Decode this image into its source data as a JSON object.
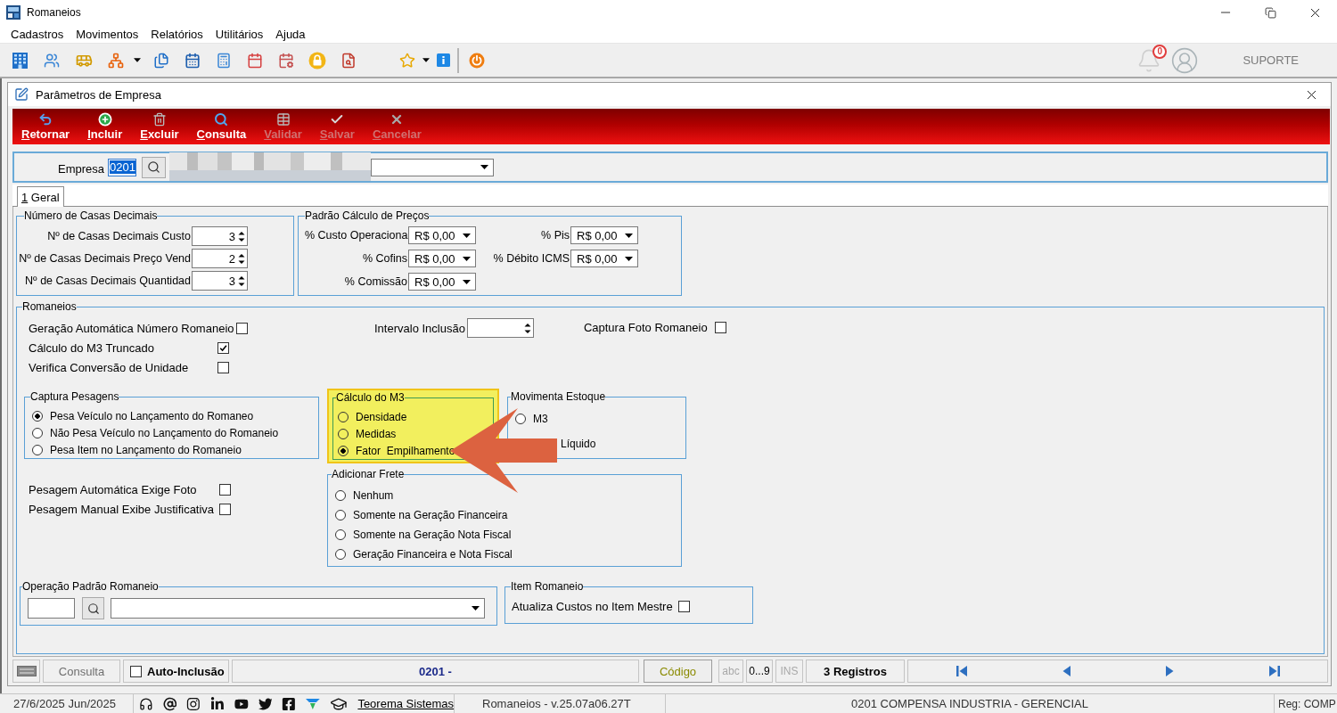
{
  "window": {
    "title": "Romaneios"
  },
  "menu": [
    "Cadastros",
    "Movimentos",
    "Relatórios",
    "Utilitários",
    "Ajuda"
  ],
  "header": {
    "notification_count": "0",
    "support": "SUPORTE"
  },
  "form": {
    "title": "Parâmetros de Empresa"
  },
  "actions": [
    {
      "label": "Retornar",
      "disabled": false
    },
    {
      "label": "Incluir",
      "disabled": false
    },
    {
      "label": "Excluir",
      "disabled": false
    },
    {
      "label": "Consulta",
      "disabled": false
    },
    {
      "label": "Validar",
      "disabled": true
    },
    {
      "label": "Salvar",
      "disabled": true
    },
    {
      "label": "Cancelar",
      "disabled": true
    }
  ],
  "empresa": {
    "label": "Empresa",
    "value": "0201",
    "value_selected": true,
    "name_blurred": true
  },
  "tabs": [
    {
      "label": "1 Geral",
      "selected": true
    }
  ],
  "casas_decimais": {
    "title": "Número de Casas Decimais",
    "rows": [
      {
        "label": "Nº de Casas Decimais Custo",
        "value": "3"
      },
      {
        "label": "Nº de Casas Decimais Preço Vend",
        "value": "2"
      },
      {
        "label": "Nº de Casas Decimais Quantidad",
        "value": "3"
      }
    ]
  },
  "padrao_calculo_precos": {
    "title": "Padrão Cálculo de Preços",
    "fields": [
      {
        "label": "% Custo Operaciona",
        "value": "R$ 0,00"
      },
      {
        "label": "% Pis",
        "value": "R$ 0,00"
      },
      {
        "label": "% Cofins",
        "value": "R$ 0,00"
      },
      {
        "label": "% Débito ICMS",
        "value": "R$ 0,00"
      },
      {
        "label": "% Comissão",
        "value": "R$ 0,00"
      }
    ]
  },
  "romaneios": {
    "title": "Romaneios",
    "options": [
      {
        "label": "Geração Automática Número Romaneio",
        "checked": false
      },
      {
        "label": "Cálculo do M3 Truncado",
        "checked": true
      },
      {
        "label": "Verifica Conversão de Unidade",
        "checked": false
      }
    ],
    "intervalo_inclusao": {
      "label": "Intervalo Inclusão"
    },
    "captura_foto": {
      "label": "Captura Foto Romaneio",
      "checked": false
    },
    "captura_pesagens": {
      "title": "Captura Pesagens",
      "options": [
        {
          "label": "Pesa Veículo no Lançamento do Romaneo",
          "selected": true
        },
        {
          "label": "Não Pesa Veículo no Lançamento do Romaneio",
          "selected": false
        },
        {
          "label": "Pesa Item no Lançamento do Romaneio",
          "selected": false
        }
      ]
    },
    "calculo_m3": {
      "title": "Cálculo do M3",
      "highlighted": true,
      "options": [
        {
          "label": "Densidade",
          "selected": false
        },
        {
          "label": "Medidas",
          "selected": false
        },
        {
          "label": "Fator  Empilhamento",
          "selected": true
        }
      ]
    },
    "movimenta_estoque": {
      "title": "Movimenta Estoque",
      "options": [
        {
          "kind": "radio",
          "label": "M3",
          "selected": false
        },
        {
          "kind": "covered",
          "label": "Líquido"
        }
      ]
    },
    "pesagem_options": [
      {
        "label": "Pesagem Automática Exige Foto",
        "checked": false
      },
      {
        "label": "Pesagem Manual Exibe Justificativa",
        "checked": false
      }
    ],
    "adicionar_frete": {
      "title": "Adicionar Frete",
      "options": [
        {
          "label": "Nenhum",
          "selected": false
        },
        {
          "label": "Somente na Geração Financeira",
          "selected": false
        },
        {
          "label": "Somente na Geração Nota Fiscal",
          "selected": false
        },
        {
          "label": "Geração Financeira e Nota Fiscal",
          "selected": false
        }
      ]
    },
    "operacao_padrao": {
      "title": "Operação Padrão Romaneio"
    },
    "item_romaneio": {
      "title": "Item Romaneio",
      "option": {
        "label": "Atualiza Custos no Item Mestre",
        "checked": false
      }
    }
  },
  "annotation": {
    "kind": "arrow"
  },
  "status_bar": {
    "mode": "Consulta",
    "auto_inclusao": {
      "label": "Auto-Inclusão",
      "checked": false
    },
    "record": "0201 -",
    "key_button": "Código",
    "indicators": [
      {
        "label": "abc",
        "active": false
      },
      {
        "label": "0...9",
        "active": true
      },
      {
        "label": "INS",
        "active": false
      }
    ],
    "count": "3 Registros"
  },
  "footer": {
    "date": "27/6/2025 Jun/2025",
    "link": "Teorema Sistemas",
    "version": "Romaneios - v.25.07a06.27T",
    "company": "0201 COMPENSA INDUSTRIA - GERENCIAL",
    "registration": "Reg: COMP"
  }
}
